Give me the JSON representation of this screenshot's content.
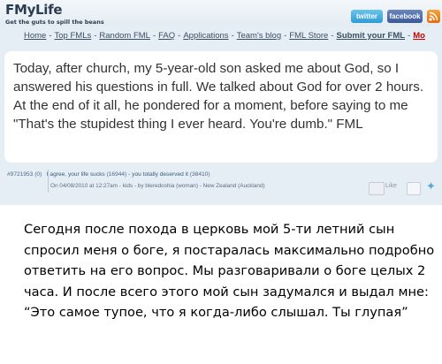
{
  "site": {
    "logo": "FMyLife",
    "tagline": "Get the guts to spill the beans",
    "twitter_label": "twitter",
    "facebook_label": "facebook"
  },
  "nav": {
    "items": [
      "Home",
      "Top FMLs",
      "Random FML",
      "FAQ",
      "Applications",
      "Team's blog",
      "FML Store",
      "Submit your FML",
      "Mo"
    ]
  },
  "post": {
    "text": "Today, after church, my 5-year-old son asked me about God, so I answered his questions in full. We talked about God for over 2 hours. At the end of it all, he pondered for a moment, before saying to me \"That's the stupidest thing I ever heard. You're dumb.\" FML",
    "id": "#9721953",
    "id_count": "(0)",
    "agree_label": "I agree, your life sucks",
    "agree_count": "(16944)",
    "deserved_label": "you totally deserved it",
    "deserved_count": "(38410)",
    "date_line": "On 04/08/2010 at 12:27am - kids - by bleredoshia",
    "gender": "(woman)",
    "location": " - New Zealand",
    "region": "(Auckland)",
    "like_label": "Like"
  },
  "translation": {
    "text": "Сегодня после похода в церковь мой 5-ти летний сын спросил меня о боге, я постаралась максимально подробно ответить на его вопрос. Мы разговаривали о боге целых 2 часа. И после всего этого мой сын задумался и выдал мне: “Это самое тупое, что я когда-либо слышал. Ты глупая”"
  }
}
